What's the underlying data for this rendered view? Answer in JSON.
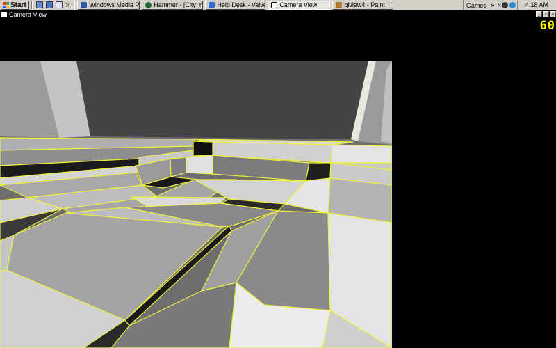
{
  "taskbar": {
    "start_label": "Start",
    "tasks": [
      {
        "label": "Windows Media Pl...",
        "icon_color": "#2a55a0",
        "active": false
      },
      {
        "label": "Hammer - [City_ni...",
        "icon_color": "#1e6b2e",
        "active": false
      },
      {
        "label": "Help Desk - Valve ...",
        "icon_color": "#3366cc",
        "active": false
      },
      {
        "label": "Camera View",
        "icon_color": "#c0c0c0",
        "active": true
      },
      {
        "label": "glview4 - Paint",
        "icon_color": "#b07a30",
        "active": false
      }
    ],
    "tray_label": "Games",
    "clock": "4:18 AM"
  },
  "window": {
    "title": "Camera View",
    "buttons": [
      "_",
      "▫",
      "×"
    ]
  },
  "fps": "60",
  "colors": {
    "edge": "#f0f040",
    "background": "#000000"
  }
}
